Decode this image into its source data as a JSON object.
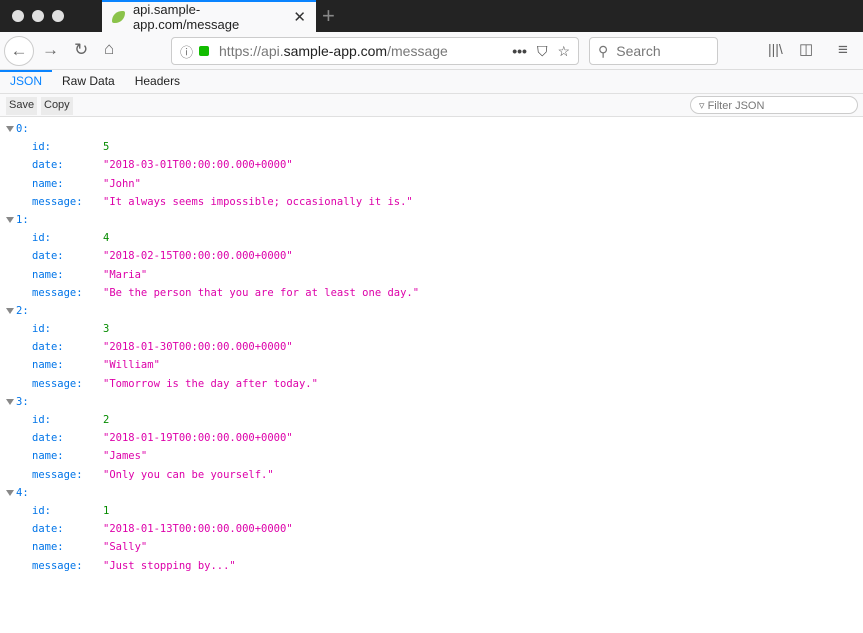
{
  "tab": {
    "title": "api.sample-app.com/message"
  },
  "address": {
    "prefix": "https://api.",
    "domain": "sample-app.com",
    "path": "/message"
  },
  "search": {
    "placeholder": "Search"
  },
  "viewer_tabs": [
    "JSON",
    "Raw Data",
    "Headers"
  ],
  "toolbar": {
    "save": "Save",
    "copy": "Copy",
    "filter_placeholder": "Filter JSON"
  },
  "records": [
    {
      "index": "0:",
      "id": "5",
      "date": "\"2018-03-01T00:00:00.000+0000\"",
      "name": "\"John\"",
      "message": "\"It always seems impossible; occasionally it is.\""
    },
    {
      "index": "1:",
      "id": "4",
      "date": "\"2018-02-15T00:00:00.000+0000\"",
      "name": "\"Maria\"",
      "message": "\"Be the person that you are for at least one day.\""
    },
    {
      "index": "2:",
      "id": "3",
      "date": "\"2018-01-30T00:00:00.000+0000\"",
      "name": "\"William\"",
      "message": "\"Tomorrow is the day after today.\""
    },
    {
      "index": "3:",
      "id": "2",
      "date": "\"2018-01-19T00:00:00.000+0000\"",
      "name": "\"James\"",
      "message": "\"Only you can be yourself.\""
    },
    {
      "index": "4:",
      "id": "1",
      "date": "\"2018-01-13T00:00:00.000+0000\"",
      "name": "\"Sally\"",
      "message": "\"Just stopping by...\""
    }
  ],
  "keys": {
    "id": "id:",
    "date": "date:",
    "name": "name:",
    "message": "message:"
  }
}
